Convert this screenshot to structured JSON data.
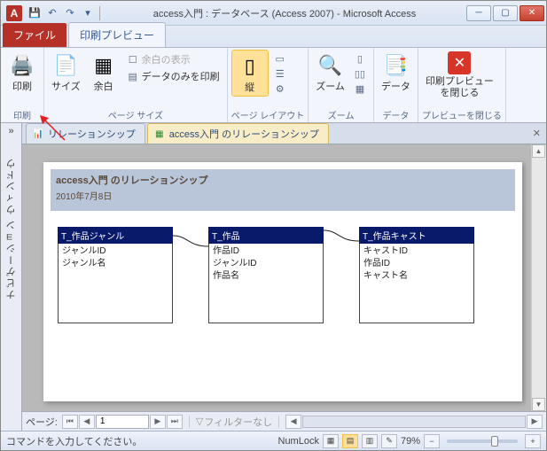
{
  "titlebar": {
    "title": "access入門 : データベース (Access 2007) - Microsoft Access",
    "app_letter": "A"
  },
  "ribbon": {
    "file_tab": "ファイル",
    "print_preview_tab": "印刷プレビュー",
    "groups": {
      "print": {
        "label": "印刷",
        "print_btn": "印刷"
      },
      "page_size": {
        "label": "ページ サイズ",
        "size_btn": "サイズ",
        "margins_btn": "余白",
        "show_margins": "余白の表示",
        "data_only": "データのみを印刷"
      },
      "page_layout": {
        "label": "ページ レイアウト",
        "portrait_btn": "縦"
      },
      "zoom": {
        "label": "ズーム",
        "zoom_btn": "ズーム"
      },
      "data": {
        "label": "データ",
        "data_btn": "データ"
      },
      "close": {
        "label": "プレビューを閉じる",
        "close_btn": "印刷プレビュー\nを閉じる"
      }
    }
  },
  "nav_pane": {
    "title": "ナビゲーション ウィンドウ"
  },
  "doc_tabs": {
    "tab1": "リレーションシップ",
    "tab2": "access入門 のリレーションシップ"
  },
  "report": {
    "title": "access入門 のリレーションシップ",
    "date": "2010年7月8日",
    "tables": [
      {
        "name": "T_作品ジャンル",
        "fields": [
          "ジャンルID",
          "ジャンル名"
        ]
      },
      {
        "name": "T_作品",
        "fields": [
          "作品ID",
          "ジャンルID",
          "作品名"
        ]
      },
      {
        "name": "T_作品キャスト",
        "fields": [
          "キャストID",
          "作品ID",
          "キャスト名"
        ]
      }
    ]
  },
  "page_nav": {
    "label": "ページ:",
    "current": "1",
    "filter": "フィルターなし"
  },
  "status": {
    "prompt": "コマンドを入力してください。",
    "numlock": "NumLock",
    "zoom": "79%"
  }
}
